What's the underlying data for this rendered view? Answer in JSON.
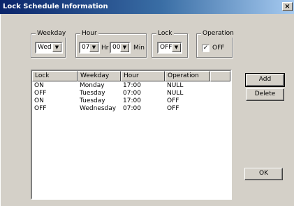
{
  "window": {
    "title": "Lock Schedule Information",
    "close_label": "×"
  },
  "weekday": {
    "legend": "Weekday",
    "value": "Wed"
  },
  "hour": {
    "legend": "Hour",
    "hour_value": "07",
    "hr_label": "Hr",
    "min_value": "00",
    "min_label": "Min"
  },
  "lock": {
    "legend": "Lock",
    "value": "OFF"
  },
  "operation": {
    "legend": "Operation",
    "checkbox_mark": "✓",
    "checkbox_label": "OFF",
    "checked": true
  },
  "list": {
    "columns": [
      "Lock",
      "Weekday",
      "Hour",
      "Operation"
    ],
    "rows": [
      [
        "ON",
        "Monday",
        "17:00",
        "NULL"
      ],
      [
        "OFF",
        "Tuesday",
        "07:00",
        "NULL"
      ],
      [
        "ON",
        "Tuesday",
        "17:00",
        "OFF"
      ],
      [
        "OFF",
        "Wednesday",
        "07:00",
        "OFF"
      ]
    ]
  },
  "buttons": {
    "add": "Add",
    "delete": "Delete",
    "ok": "OK"
  }
}
